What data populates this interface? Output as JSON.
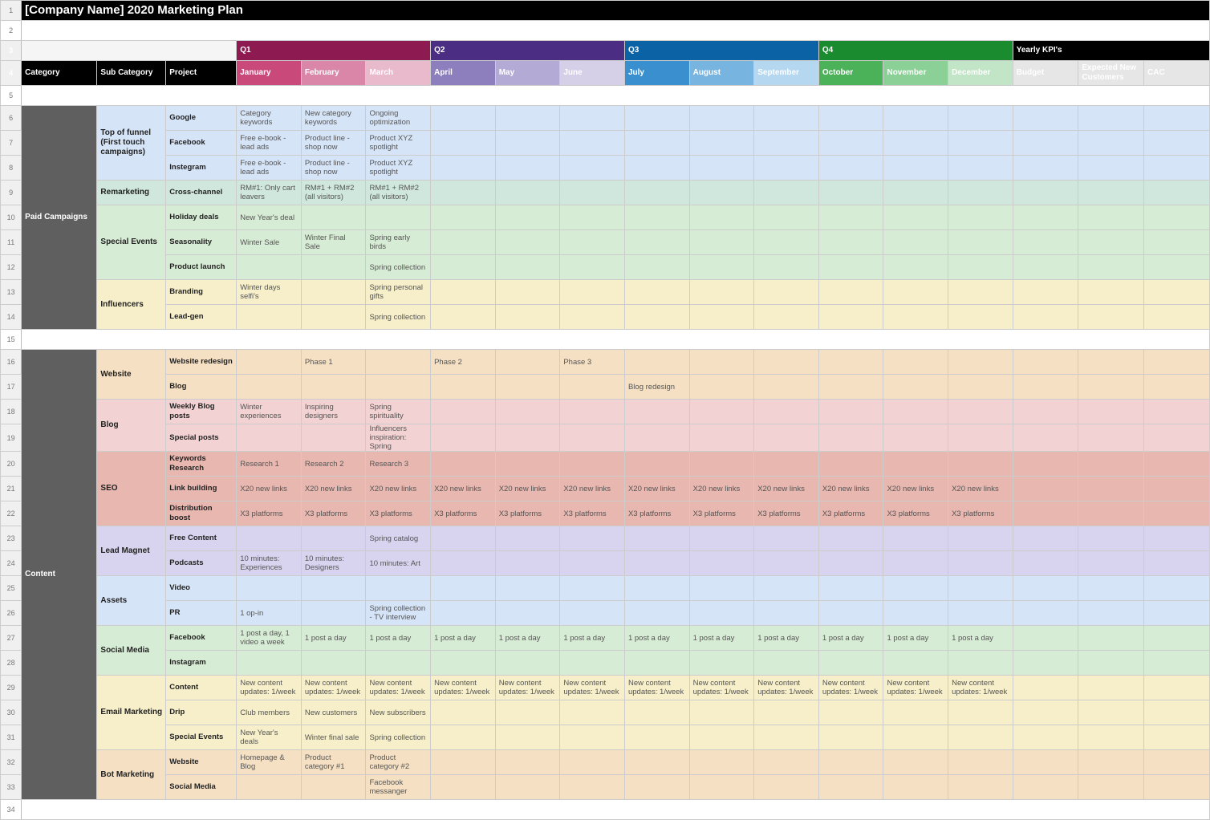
{
  "title": "[Company Name] 2020 Marketing Plan",
  "quarters": {
    "q1": "Q1",
    "q2": "Q2",
    "q3": "Q3",
    "q4": "Q4",
    "kpis": "Yearly KPI's"
  },
  "headers": {
    "category": "Category",
    "subcategory": "Sub Category",
    "project": "Project",
    "months": [
      "January",
      "February",
      "March",
      "April",
      "May",
      "June",
      "July",
      "August",
      "September",
      "October",
      "November",
      "December"
    ],
    "kpis": [
      "Budget",
      "Expected New Customers",
      "CAC"
    ]
  },
  "sections": [
    {
      "category": "Paid Campaigns",
      "tint_cat": "cat",
      "rows": [
        {
          "tint": "t-blue",
          "sub": "Top of funnel (First touch campaigns)",
          "subspan": 3,
          "project": "Google",
          "months": [
            "Category keywords",
            "New category keywords",
            "Ongoing optimization",
            "",
            "",
            "",
            "",
            "",
            "",
            "",
            "",
            ""
          ]
        },
        {
          "tint": "t-blue",
          "project": "Facebook",
          "months": [
            "Free e-book - lead ads",
            "Product line - shop now",
            "Product XYZ spotlight",
            "",
            "",
            "",
            "",
            "",
            "",
            "",
            "",
            ""
          ]
        },
        {
          "tint": "t-blue",
          "project": "Instegram",
          "months": [
            "Free e-book - lead ads",
            "Product line - shop now",
            "Product XYZ spotlight",
            "",
            "",
            "",
            "",
            "",
            "",
            "",
            "",
            ""
          ]
        },
        {
          "tint": "t-teal",
          "sub": "Remarketing",
          "subspan": 1,
          "project": "Cross-channel",
          "months": [
            "RM#1: Only cart leavers",
            "RM#1 + RM#2 (all visitors)",
            "RM#1 + RM#2 (all visitors)",
            "",
            "",
            "",
            "",
            "",
            "",
            "",
            "",
            ""
          ]
        },
        {
          "tint": "t-green",
          "sub": "Special Events",
          "subspan": 3,
          "project": "Holiday deals",
          "months": [
            "New Year's deal",
            "",
            "",
            "",
            "",
            "",
            "",
            "",
            "",
            "",
            "",
            ""
          ]
        },
        {
          "tint": "t-green",
          "project": "Seasonality",
          "months": [
            "Winter Sale",
            "Winter Final Sale",
            "Spring early birds",
            "",
            "",
            "",
            "",
            "",
            "",
            "",
            "",
            ""
          ]
        },
        {
          "tint": "t-green",
          "project": "Product launch",
          "months": [
            "",
            "",
            "Spring collection",
            "",
            "",
            "",
            "",
            "",
            "",
            "",
            "",
            ""
          ]
        },
        {
          "tint": "t-yellow",
          "sub": "Influencers",
          "subspan": 2,
          "project": "Branding",
          "months": [
            "Winter days selfi's",
            "",
            "Spring personal gifts",
            "",
            "",
            "",
            "",
            "",
            "",
            "",
            "",
            ""
          ]
        },
        {
          "tint": "t-yellow",
          "project": "Lead-gen",
          "months": [
            "",
            "",
            "Spring collection",
            "",
            "",
            "",
            "",
            "",
            "",
            "",
            "",
            ""
          ]
        }
      ]
    },
    {
      "spacer": true
    },
    {
      "category": "Content",
      "tint_cat": "cat",
      "rows": [
        {
          "tint": "t-orange",
          "sub": "Website",
          "subspan": 2,
          "project": "Website redesign",
          "months": [
            "",
            "Phase 1",
            "",
            "Phase 2",
            "",
            "Phase 3",
            "",
            "",
            "",
            "",
            "",
            ""
          ]
        },
        {
          "tint": "t-orange",
          "project": "Blog",
          "months": [
            "",
            "",
            "",
            "",
            "",
            "",
            "Blog redesign",
            "",
            "",
            "",
            "",
            ""
          ]
        },
        {
          "tint": "t-pink",
          "sub": "Blog",
          "subspan": 2,
          "project": "Weekly Blog posts",
          "months": [
            "Winter experiences",
            "Inspiring designers",
            "Spring spirituality",
            "",
            "",
            "",
            "",
            "",
            "",
            "",
            "",
            ""
          ]
        },
        {
          "tint": "t-pink",
          "project": "Special posts",
          "months": [
            "",
            "",
            "Influencers inspiration: Spring",
            "",
            "",
            "",
            "",
            "",
            "",
            "",
            "",
            ""
          ]
        },
        {
          "tint": "t-rose",
          "sub": "SEO",
          "subspan": 3,
          "project": "Keywords Research",
          "months": [
            "Research 1",
            "Research 2",
            "Research 3",
            "",
            "",
            "",
            "",
            "",
            "",
            "",
            "",
            ""
          ]
        },
        {
          "tint": "t-rose",
          "project": "Link building",
          "months": [
            "X20 new links",
            "X20 new links",
            "X20 new links",
            "X20 new links",
            "X20 new links",
            "X20 new links",
            "X20 new links",
            "X20 new links",
            "X20 new links",
            "X20 new links",
            "X20 new links",
            "X20 new links"
          ]
        },
        {
          "tint": "t-rose",
          "project": "Distribution boost",
          "months": [
            "X3 platforms",
            "X3 platforms",
            "X3 platforms",
            "X3 platforms",
            "X3 platforms",
            "X3 platforms",
            "X3 platforms",
            "X3 platforms",
            "X3 platforms",
            "X3 platforms",
            "X3 platforms",
            "X3 platforms"
          ]
        },
        {
          "tint": "t-lav",
          "sub": "Lead Magnet",
          "subspan": 2,
          "project": "Free Content",
          "months": [
            "",
            "",
            "Spring catalog",
            "",
            "",
            "",
            "",
            "",
            "",
            "",
            "",
            ""
          ]
        },
        {
          "tint": "t-lav",
          "project": "Podcasts",
          "months": [
            "10 minutes: Experiences",
            "10 minutes: Designers",
            "10 minutes: Art",
            "",
            "",
            "",
            "",
            "",
            "",
            "",
            "",
            ""
          ]
        },
        {
          "tint": "t-blue",
          "sub": "Assets",
          "subspan": 2,
          "project": "Video",
          "months": [
            "",
            "",
            "",
            "",
            "",
            "",
            "",
            "",
            "",
            "",
            "",
            ""
          ]
        },
        {
          "tint": "t-blue",
          "project": "PR",
          "months": [
            "1 op-in",
            "",
            "Spring collection - TV interview",
            "",
            "",
            "",
            "",
            "",
            "",
            "",
            "",
            ""
          ]
        },
        {
          "tint": "t-green",
          "sub": "Social Media",
          "subspan": 2,
          "project": "Facebook",
          "months": [
            "1 post a day, 1 video a week",
            "1 post a day",
            "1 post a day",
            "1 post a day",
            "1 post a day",
            "1 post a day",
            "1 post a day",
            "1 post a day",
            "1 post a day",
            "1 post a day",
            "1 post a day",
            "1 post a day"
          ]
        },
        {
          "tint": "t-green",
          "project": "Instagram",
          "months": [
            "",
            "",
            "",
            "",
            "",
            "",
            "",
            "",
            "",
            "",
            "",
            ""
          ]
        },
        {
          "tint": "t-yellow",
          "sub": "Email Marketing",
          "subspan": 3,
          "project": "Content",
          "months": [
            "New content updates: 1/week",
            "New content updates: 1/week",
            "New content updates: 1/week",
            "New content updates: 1/week",
            "New content updates: 1/week",
            "New content updates: 1/week",
            "New content updates: 1/week",
            "New content updates: 1/week",
            "New content updates: 1/week",
            "New content updates: 1/week",
            "New content updates: 1/week",
            "New content updates: 1/week"
          ]
        },
        {
          "tint": "t-yellow",
          "project": "Drip",
          "months": [
            "Club members",
            "New customers",
            "New subscribers",
            "",
            "",
            "",
            "",
            "",
            "",
            "",
            "",
            ""
          ]
        },
        {
          "tint": "t-yellow",
          "project": "Special Events",
          "months": [
            "New Year's deals",
            "Winter final sale",
            "Spring collection",
            "",
            "",
            "",
            "",
            "",
            "",
            "",
            "",
            ""
          ]
        },
        {
          "tint": "t-orange",
          "sub": "Bot Marketing",
          "subspan": 2,
          "project": "Website",
          "months": [
            "Homepage & Blog",
            "Product category #1",
            "Product category #2",
            "",
            "",
            "",
            "",
            "",
            "",
            "",
            "",
            ""
          ]
        },
        {
          "tint": "t-orange",
          "project": "Social Media",
          "months": [
            "",
            "",
            "Facebook messanger",
            "",
            "",
            "",
            "",
            "",
            "",
            "",
            "",
            ""
          ]
        }
      ]
    },
    {
      "spacer": true
    }
  ]
}
